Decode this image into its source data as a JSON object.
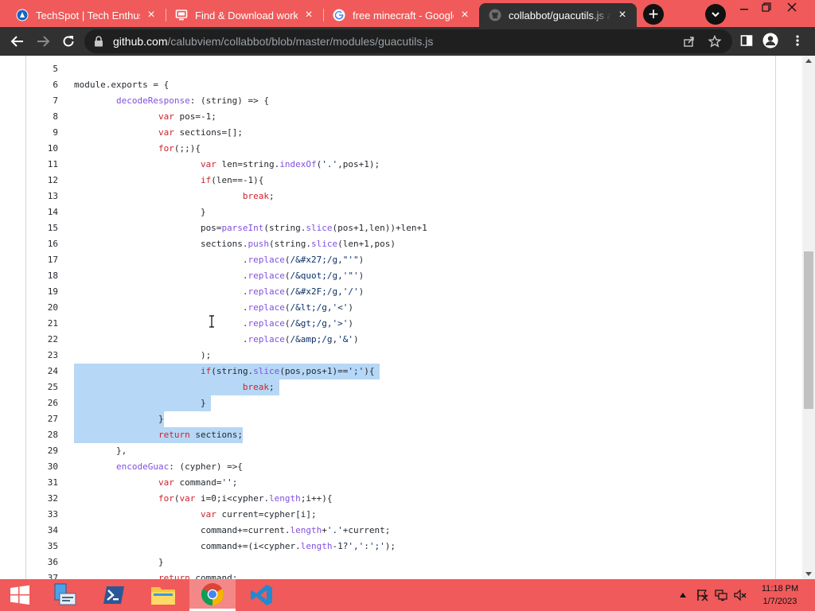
{
  "browser": {
    "tabs": [
      {
        "title": "TechSpot | Tech Enthusiast",
        "favicon": "techspot-icon",
        "active": false
      },
      {
        "title": "Find & Download working",
        "favicon": "monitor-icon",
        "active": false
      },
      {
        "title": "free minecraft - Google S",
        "favicon": "google-icon",
        "active": false
      },
      {
        "title": "collabbot/guacutils.js at master",
        "favicon": "github-icon",
        "active": true
      }
    ],
    "new_tab_label": "+",
    "url_host": "github.com",
    "url_path": "/calubviem/collabbot/blob/master/modules/guacutils.js"
  },
  "code": {
    "lines": [
      {
        "n": "5",
        "html": ""
      },
      {
        "n": "6",
        "html": "module.exports = {"
      },
      {
        "n": "7",
        "html": "        <span class=\"fn\">decodeResponse</span>: (string) => {"
      },
      {
        "n": "8",
        "html": "                <span class=\"kw\">var</span> pos=-1;"
      },
      {
        "n": "9",
        "html": "                <span class=\"kw\">var</span> sections=[];"
      },
      {
        "n": "10",
        "html": "                <span class=\"kw\">for</span>(;;){"
      },
      {
        "n": "11",
        "html": "                        <span class=\"kw\">var</span> len=string.<span class=\"fn\">indexOf</span>(<span class=\"str\">'.'</span>,pos+1);"
      },
      {
        "n": "12",
        "html": "                        <span class=\"kw\">if</span>(len==-1){"
      },
      {
        "n": "13",
        "html": "                                <span class=\"kw\">break</span>;"
      },
      {
        "n": "14",
        "html": "                        }"
      },
      {
        "n": "15",
        "html": "                        pos=<span class=\"fn\">parseInt</span>(string.<span class=\"fn\">slice</span>(pos+1,len))+len+1"
      },
      {
        "n": "16",
        "html": "                        sections.<span class=\"fn\">push</span>(string.<span class=\"fn\">slice</span>(len+1,pos)"
      },
      {
        "n": "17",
        "html": "                                .<span class=\"fn\">replace</span>(<span class=\"str\">/&amp;#x27;/g</span>,<span class=\"str\">\"'\"</span>)"
      },
      {
        "n": "18",
        "html": "                                .<span class=\"fn\">replace</span>(<span class=\"str\">/&amp;quot;/g</span>,<span class=\"str\">'\"'</span>)"
      },
      {
        "n": "19",
        "html": "                                .<span class=\"fn\">replace</span>(<span class=\"str\">/&amp;#x2F;/g</span>,<span class=\"str\">'/'</span>)"
      },
      {
        "n": "20",
        "html": "                                .<span class=\"fn\">replace</span>(<span class=\"str\">/&amp;lt;/g</span>,<span class=\"str\">'&lt;'</span>)"
      },
      {
        "n": "21",
        "html": "                                .<span class=\"fn\">replace</span>(<span class=\"str\">/&amp;gt;/g</span>,<span class=\"str\">'&gt;'</span>)"
      },
      {
        "n": "22",
        "html": "                                .<span class=\"fn\">replace</span>(<span class=\"str\">/&amp;amp;/g</span>,<span class=\"str\">'&amp;'</span>)"
      },
      {
        "n": "23",
        "html": "                        );"
      },
      {
        "n": "24",
        "html": "                        <span class=\"kw\">if</span>(string.<span class=\"fn\">slice</span>(pos,pos+1)==<span class=\"str\">';'</span>){"
      },
      {
        "n": "25",
        "html": "                                <span class=\"kw\">break</span>;"
      },
      {
        "n": "26",
        "html": "                        }"
      },
      {
        "n": "27",
        "html": "                }"
      },
      {
        "n": "28",
        "html": "                <span class=\"kw\">return</span> sections;"
      },
      {
        "n": "29",
        "html": "        },"
      },
      {
        "n": "30",
        "html": "        <span class=\"fn\">encodeGuac</span>: (cypher) =>{"
      },
      {
        "n": "31",
        "html": "                <span class=\"kw\">var</span> command=<span class=\"str\">''</span>;"
      },
      {
        "n": "32",
        "html": "                <span class=\"kw\">for</span>(<span class=\"kw\">var</span> i=0;i&lt;cypher.<span class=\"fn\">length</span>;i++){"
      },
      {
        "n": "33",
        "html": "                        <span class=\"kw\">var</span> current=cypher[i];"
      },
      {
        "n": "34",
        "html": "                        command+=current.<span class=\"fn\">length</span>+<span class=\"str\">'.'</span>+current;"
      },
      {
        "n": "35",
        "html": "                        command+=(i&lt;cypher.<span class=\"fn\">length</span>-1?<span class=\"str\">','</span>:<span class=\"str\">';'</span>);"
      },
      {
        "n": "36",
        "html": "                }"
      },
      {
        "n": "37",
        "html": "                <span class=\"kw\">return</span> command;"
      }
    ],
    "selected_lines": [
      "24",
      "25",
      "26",
      "27",
      "28"
    ]
  },
  "taskbar": {
    "apps": [
      {
        "name": "file-manager-icon",
        "active": false
      },
      {
        "name": "powershell-icon",
        "active": false
      },
      {
        "name": "file-explorer-icon",
        "active": false
      },
      {
        "name": "chrome-icon",
        "active": true
      },
      {
        "name": "vscode-icon",
        "active": false
      }
    ],
    "time": "11:18 PM",
    "date": "1/7/2023"
  },
  "colors": {
    "accent": "#f05a5a",
    "toolbar": "#313131",
    "selection": "#b6d7f5"
  }
}
